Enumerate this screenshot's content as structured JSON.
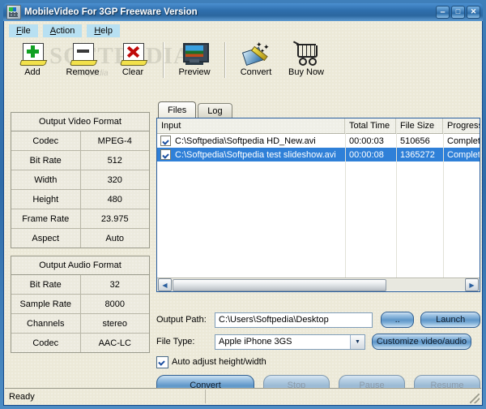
{
  "window": {
    "title": "MobileVideo For 3GP Freeware Version",
    "icon": "mobile-device-icon",
    "minimize_label": "–",
    "maximize_label": "□",
    "close_label": "✕"
  },
  "menubar": {
    "items": [
      {
        "label": "File",
        "accesskey": "F"
      },
      {
        "label": "Action",
        "accesskey": "A"
      },
      {
        "label": "Help",
        "accesskey": "H"
      }
    ]
  },
  "toolbar": {
    "watermark": "SOFTPEDIA",
    "watermark_small": "softpedia",
    "buttons": [
      {
        "label": "Add",
        "icon": "add-file-icon"
      },
      {
        "label": "Remove",
        "icon": "remove-file-icon"
      },
      {
        "label": "Clear",
        "icon": "clear-list-icon"
      },
      {
        "label": "Preview",
        "icon": "monitor-preview-icon"
      },
      {
        "label": "Convert",
        "icon": "magic-wand-convert-icon"
      },
      {
        "label": "Buy Now",
        "icon": "shopping-cart-icon"
      }
    ]
  },
  "video_format": {
    "header": "Output Video Format",
    "rows": [
      {
        "key": "Codec",
        "value": "MPEG-4"
      },
      {
        "key": "Bit Rate",
        "value": "512"
      },
      {
        "key": "Width",
        "value": "320"
      },
      {
        "key": "Height",
        "value": "480"
      },
      {
        "key": "Frame Rate",
        "value": "23.975"
      },
      {
        "key": "Aspect",
        "value": "Auto"
      }
    ]
  },
  "audio_format": {
    "header": "Output Audio Format",
    "rows": [
      {
        "key": "Bit Rate",
        "value": "32"
      },
      {
        "key": "Sample Rate",
        "value": "8000"
      },
      {
        "key": "Channels",
        "value": "stereo"
      },
      {
        "key": "Codec",
        "value": "AAC-LC"
      }
    ]
  },
  "tabs": [
    {
      "label": "Files",
      "active": true
    },
    {
      "label": "Log",
      "active": false
    }
  ],
  "file_list": {
    "columns": [
      "Input",
      "Total Time",
      "File Size",
      "Progress"
    ],
    "rows": [
      {
        "checked": true,
        "selected": false,
        "input": "C:\\Softpedia\\Softpedia HD_New.avi",
        "total_time": "00:00:03",
        "file_size": "510656",
        "progress": "Complet..."
      },
      {
        "checked": true,
        "selected": true,
        "input": "C:\\Softpedia\\Softpedia test slideshow.avi",
        "total_time": "00:00:08",
        "file_size": "1365272",
        "progress": "Complet..."
      }
    ],
    "scroll_left_icon": "◀",
    "scroll_right_icon": "▶"
  },
  "output_path": {
    "label": "Output Path:",
    "value": "C:\\Users\\Softpedia\\Desktop",
    "browse_label": "..",
    "launch_label": "Launch"
  },
  "file_type": {
    "label": "File Type:",
    "value": "Apple iPhone 3GS",
    "dropdown_icon": "▼",
    "customize_label": "Customize video/audio"
  },
  "auto_adjust": {
    "label": "Auto adjust height/width",
    "checked": true
  },
  "actions": [
    {
      "label": "Convert",
      "enabled": true
    },
    {
      "label": "Stop",
      "enabled": false
    },
    {
      "label": "Pause",
      "enabled": false
    },
    {
      "label": "Resume",
      "enabled": false
    }
  ],
  "statusbar": {
    "text": "Ready"
  },
  "colors": {
    "titlebar": "#2f6fad",
    "selection": "#2f80d8",
    "client": "#ece9d8",
    "menu_item": "#b8e0f2"
  }
}
